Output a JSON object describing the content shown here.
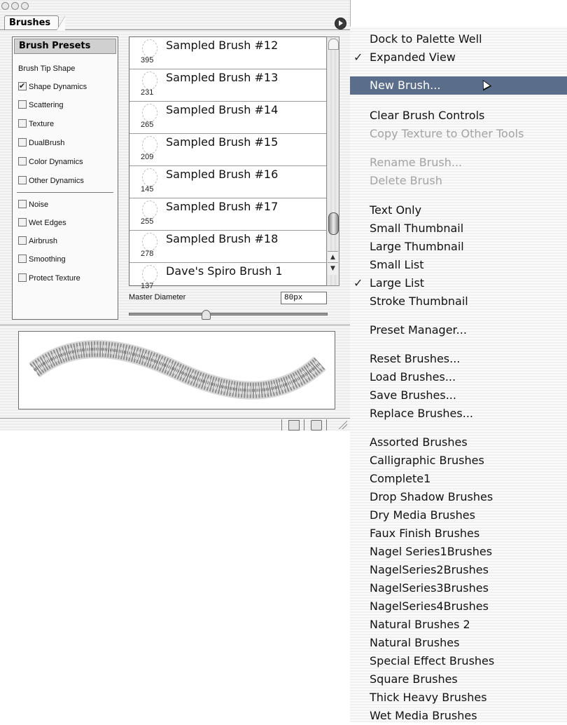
{
  "palette": {
    "tab_label": "Brushes",
    "left_panel": {
      "title": "Brush Presets",
      "items": [
        {
          "label": "Brush Tip Shape",
          "has_checkbox": false,
          "checked": false
        },
        {
          "label": "Shape Dynamics",
          "has_checkbox": true,
          "checked": true
        },
        {
          "label": "Scattering",
          "has_checkbox": true,
          "checked": false
        },
        {
          "label": "Texture",
          "has_checkbox": true,
          "checked": false
        },
        {
          "label": "DualBrush",
          "has_checkbox": true,
          "checked": false
        },
        {
          "label": "Color Dynamics",
          "has_checkbox": true,
          "checked": false
        },
        {
          "label": "Other Dynamics",
          "has_checkbox": true,
          "checked": false
        },
        {
          "label": "Noise",
          "has_checkbox": true,
          "checked": false
        },
        {
          "label": "Wet Edges",
          "has_checkbox": true,
          "checked": false
        },
        {
          "label": "Airbrush",
          "has_checkbox": true,
          "checked": false
        },
        {
          "label": "Smoothing",
          "has_checkbox": true,
          "checked": false
        },
        {
          "label": "Protect Texture",
          "has_checkbox": true,
          "checked": false
        }
      ]
    },
    "brushes": [
      {
        "name": "Sampled Brush #12",
        "size": "395"
      },
      {
        "name": "Sampled Brush #13",
        "size": "231"
      },
      {
        "name": "Sampled Brush #14",
        "size": "265"
      },
      {
        "name": "Sampled Brush #15",
        "size": "209"
      },
      {
        "name": "Sampled Brush #16",
        "size": "145"
      },
      {
        "name": "Sampled Brush #17",
        "size": "255"
      },
      {
        "name": "Sampled Brush #18",
        "size": "278"
      },
      {
        "name": "Dave's Spiro Brush 1",
        "size": "137"
      }
    ],
    "master_diameter": {
      "label": "Master Diameter",
      "value": "80px"
    },
    "scroll_position": 0.92
  },
  "menu": {
    "items": [
      {
        "label": "Dock to Palette Well",
        "checked": false,
        "disabled": false,
        "highlight": false
      },
      {
        "label": "Expanded View",
        "checked": true,
        "disabled": false,
        "highlight": false
      },
      {
        "label": "New Brush...",
        "checked": false,
        "disabled": false,
        "highlight": true
      },
      {
        "label": "Clear Brush Controls",
        "checked": false,
        "disabled": false,
        "highlight": false
      },
      {
        "label": "Copy Texture to Other Tools",
        "checked": false,
        "disabled": true,
        "highlight": false
      },
      {
        "label": "Rename Brush...",
        "checked": false,
        "disabled": true,
        "highlight": false
      },
      {
        "label": "Delete Brush",
        "checked": false,
        "disabled": true,
        "highlight": false
      },
      {
        "label": "Text Only",
        "checked": false,
        "disabled": false,
        "highlight": false
      },
      {
        "label": "Small Thumbnail",
        "checked": false,
        "disabled": false,
        "highlight": false
      },
      {
        "label": "Large Thumbnail",
        "checked": false,
        "disabled": false,
        "highlight": false
      },
      {
        "label": "Small List",
        "checked": false,
        "disabled": false,
        "highlight": false
      },
      {
        "label": "Large List",
        "checked": true,
        "disabled": false,
        "highlight": false
      },
      {
        "label": "Stroke Thumbnail",
        "checked": false,
        "disabled": false,
        "highlight": false
      },
      {
        "label": "Preset Manager...",
        "checked": false,
        "disabled": false,
        "highlight": false
      },
      {
        "label": "Reset Brushes...",
        "checked": false,
        "disabled": false,
        "highlight": false
      },
      {
        "label": "Load Brushes...",
        "checked": false,
        "disabled": false,
        "highlight": false
      },
      {
        "label": "Save Brushes...",
        "checked": false,
        "disabled": false,
        "highlight": false
      },
      {
        "label": "Replace Brushes...",
        "checked": false,
        "disabled": false,
        "highlight": false
      },
      {
        "label": "Assorted Brushes",
        "checked": false,
        "disabled": false,
        "highlight": false
      },
      {
        "label": "Calligraphic Brushes",
        "checked": false,
        "disabled": false,
        "highlight": false
      },
      {
        "label": "Complete1",
        "checked": false,
        "disabled": false,
        "highlight": false
      },
      {
        "label": "Drop Shadow Brushes",
        "checked": false,
        "disabled": false,
        "highlight": false
      },
      {
        "label": "Dry Media Brushes",
        "checked": false,
        "disabled": false,
        "highlight": false
      },
      {
        "label": "Faux Finish Brushes",
        "checked": false,
        "disabled": false,
        "highlight": false
      },
      {
        "label": "Nagel Series1Brushes",
        "checked": false,
        "disabled": false,
        "highlight": false
      },
      {
        "label": "NagelSeries2Brushes",
        "checked": false,
        "disabled": false,
        "highlight": false
      },
      {
        "label": "NagelSeries3Brushes",
        "checked": false,
        "disabled": false,
        "highlight": false
      },
      {
        "label": "NagelSeries4Brushes",
        "checked": false,
        "disabled": false,
        "highlight": false
      },
      {
        "label": "Natural Brushes 2",
        "checked": false,
        "disabled": false,
        "highlight": false
      },
      {
        "label": "Natural Brushes",
        "checked": false,
        "disabled": false,
        "highlight": false
      },
      {
        "label": "Special Effect Brushes",
        "checked": false,
        "disabled": false,
        "highlight": false
      },
      {
        "label": "Square Brushes",
        "checked": false,
        "disabled": false,
        "highlight": false
      },
      {
        "label": "Thick Heavy Brushes",
        "checked": false,
        "disabled": false,
        "highlight": false
      },
      {
        "label": "Wet Media Brushes",
        "checked": false,
        "disabled": false,
        "highlight": false
      }
    ]
  },
  "colors": {
    "menu_highlight": "#5a6d8a",
    "disabled_text": "#a3a3a3"
  }
}
